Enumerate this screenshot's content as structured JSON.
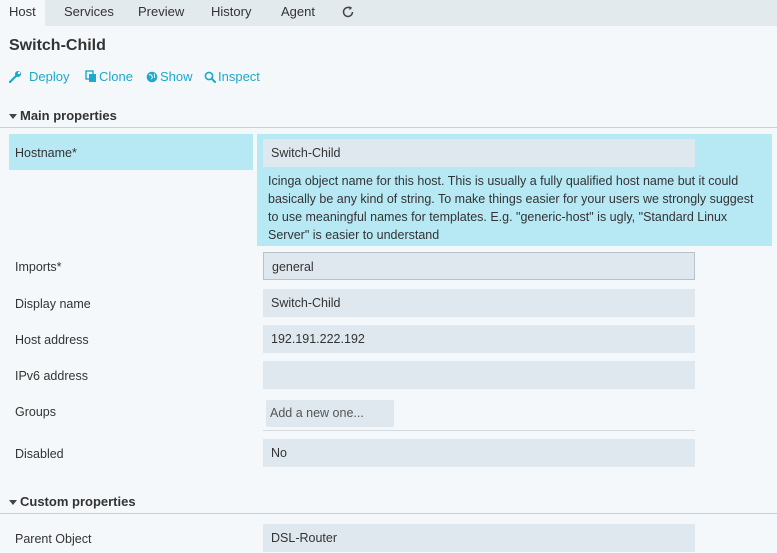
{
  "tabs": [
    {
      "label": "Host",
      "active": true
    },
    {
      "label": "Services"
    },
    {
      "label": "Preview"
    },
    {
      "label": "History"
    },
    {
      "label": "Agent"
    }
  ],
  "refresh_icon": "refresh-icon",
  "page_title": "Switch-Child",
  "actions": {
    "deploy": {
      "label": "Deploy",
      "icon": "wrench-icon"
    },
    "clone": {
      "label": "Clone",
      "icon": "copy-icon"
    },
    "show": {
      "label": "Show",
      "icon": "globe-icon"
    },
    "inspect": {
      "label": "Inspect",
      "icon": "magnifier-icon"
    }
  },
  "sections": {
    "main": "Main properties",
    "custom": "Custom properties"
  },
  "fields": {
    "hostname": {
      "label": "Hostname*",
      "value": "Switch-Child",
      "hint": "Icinga object name for this host. This is usually a fully qualified host name but it could basically be any kind of string. To make things easier for your users we strongly suggest to use meaningful names for templates. E.g. \"generic-host\" is ugly, \"Standard Linux Server\" is easier to understand"
    },
    "imports": {
      "label": "Imports*",
      "value": "general"
    },
    "display_name": {
      "label": "Display name",
      "value": "Switch-Child"
    },
    "host_address": {
      "label": "Host address",
      "value": "192.191.222.192"
    },
    "ipv6_address": {
      "label": "IPv6 address",
      "value": ""
    },
    "groups": {
      "label": "Groups",
      "placeholder": "Add a new one..."
    },
    "disabled": {
      "label": "Disabled",
      "value": "No"
    },
    "parent_object": {
      "label": "Parent Object",
      "value": "DSL-Router"
    }
  },
  "colors": {
    "accent": "#1fa7cc",
    "highlight": "#b7e9f4",
    "input_bg": "#dfe8ee"
  }
}
